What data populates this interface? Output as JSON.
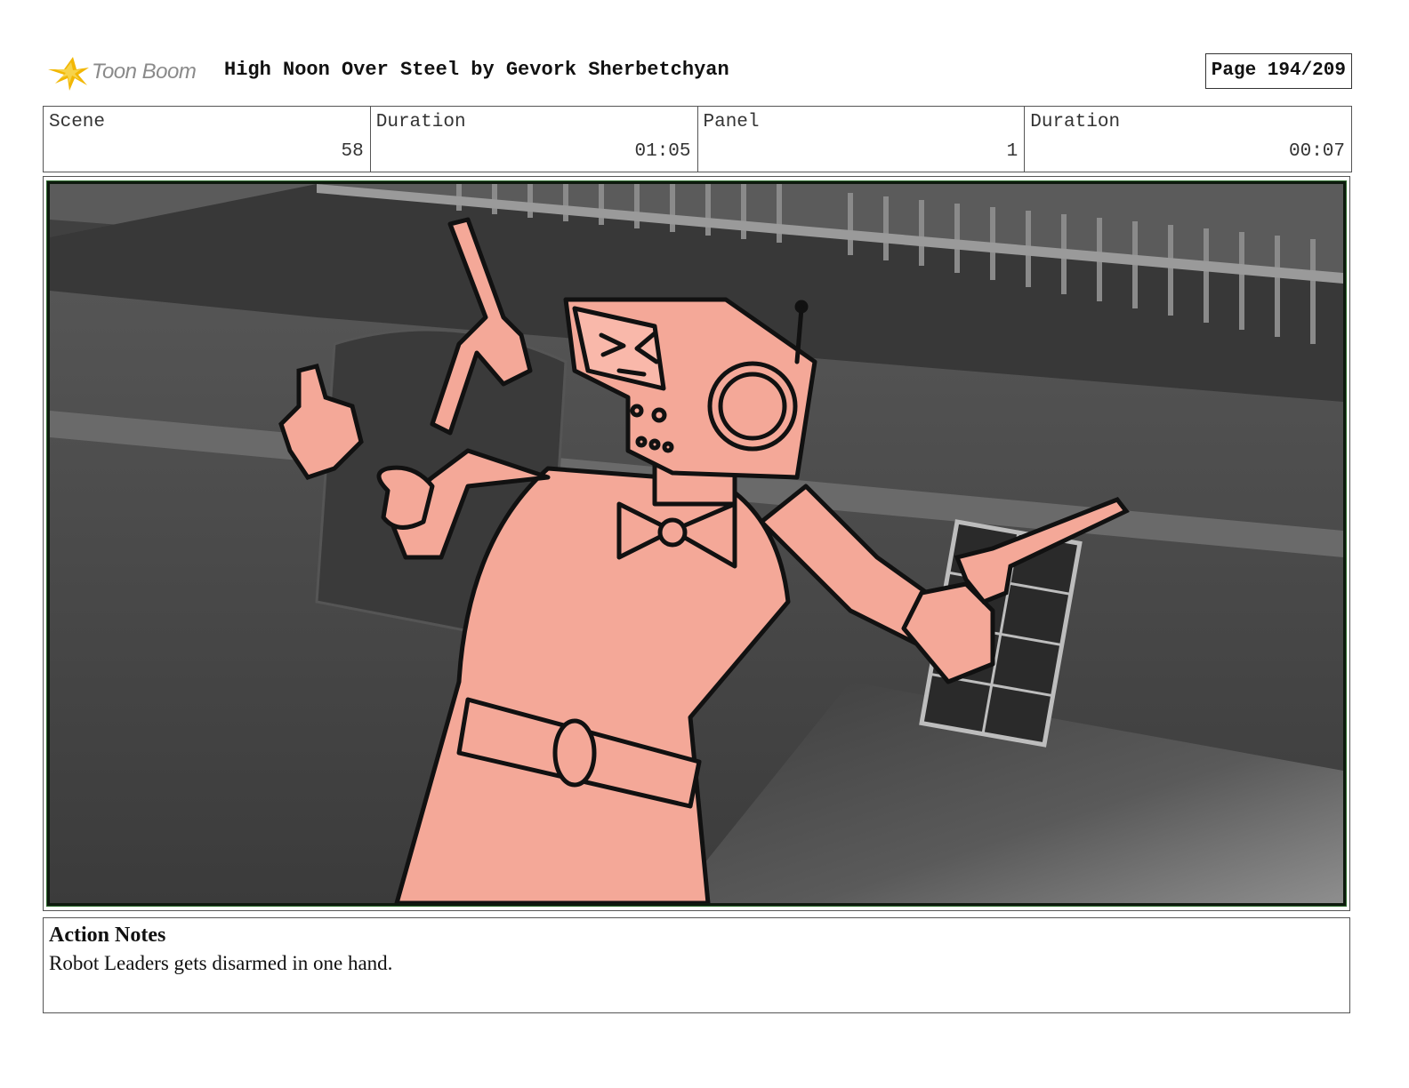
{
  "header": {
    "logo_text": "Toon Boom",
    "title": "High Noon Over Steel by Gevork Sherbetchyan",
    "page": "Page 194/209"
  },
  "info": {
    "scene_label": "Scene",
    "scene_value": "58",
    "scene_duration_label": "Duration",
    "scene_duration_value": "01:05",
    "panel_label": "Panel",
    "panel_value": "1",
    "panel_duration_label": "Duration",
    "panel_duration_value": "00:07"
  },
  "notes": {
    "title": "Action Notes",
    "text": "Robot Leaders gets disarmed in one hand."
  },
  "colors": {
    "accent_logo": "#f2b705",
    "character_fill": "#f4a898",
    "background_gray": "#4a4a4a",
    "panel_border": "#2f6d2f"
  }
}
